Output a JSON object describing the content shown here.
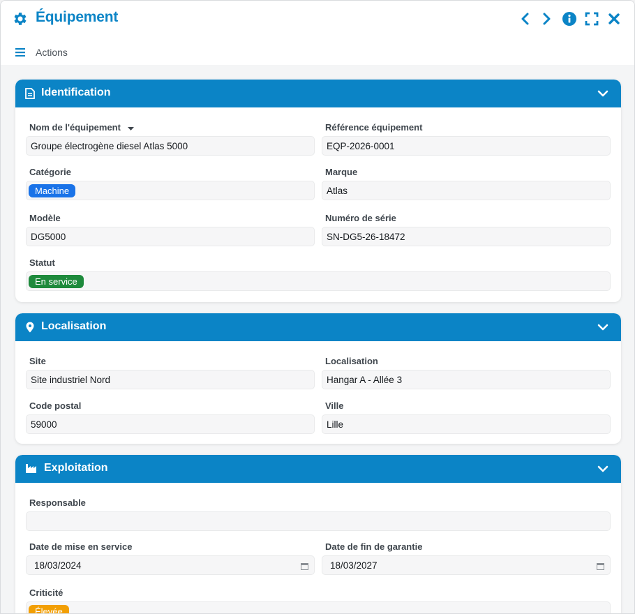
{
  "window": {
    "title": "Équipement",
    "icons": [
      "gear-icon",
      "chevron-left-icon",
      "chevron-right-icon",
      "info-icon",
      "fullscreen-icon",
      "close-icon"
    ]
  },
  "toolbar": {
    "actions_label": "Actions"
  },
  "colors": {
    "accent": "#0b84c6",
    "badge_category": "#1a73e8",
    "badge_status": "#1e8a3c",
    "badge_criticity": "#f29f05"
  },
  "identification": {
    "title": "Identification",
    "name_label": "Nom de l'équipement",
    "name_value": "Groupe électrogène diesel Atlas 5000",
    "reference_label": "Référence équipement",
    "reference_value": "EQP-2026-0001",
    "category_label": "Catégorie",
    "category_value": "Machine",
    "brand_label": "Marque",
    "brand_value": "Atlas",
    "model_label": "Modèle",
    "model_value": "DG5000",
    "serial_label": "Numéro de série",
    "serial_value": "SN-DG5-26-18472",
    "status_label": "Statut",
    "status_value": "En service"
  },
  "localisation": {
    "title": "Localisation",
    "site_label": "Site",
    "site_value": "Site industriel Nord",
    "location_label": "Localisation",
    "location_value": "Hangar A - Allée 3",
    "postal_label": "Code postal",
    "postal_value": "59000",
    "city_label": "Ville",
    "city_value": "Lille"
  },
  "exploitation": {
    "title": "Exploitation",
    "responsible_label": "Responsable",
    "responsible_value": "",
    "start_date_label": "Date de mise en service",
    "start_date_value": "18/03/2024",
    "warranty_label": "Date de fin de garantie",
    "warranty_value": "18/03/2027",
    "criticity_label": "Criticité",
    "criticity_value": "Élevée"
  }
}
